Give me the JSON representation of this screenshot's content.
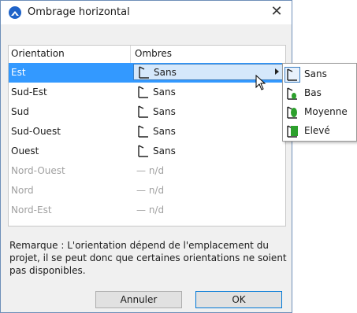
{
  "window": {
    "title": "Ombrage horizontal",
    "close_glyph": "✕",
    "app_icon": "app-logo-icon"
  },
  "table": {
    "headers": [
      "Orientation",
      "Ombres"
    ],
    "rows": [
      {
        "orientation": "Est",
        "shade": "Sans",
        "selected": true,
        "disabled": false
      },
      {
        "orientation": "Sud-Est",
        "shade": "Sans",
        "selected": false,
        "disabled": false
      },
      {
        "orientation": "Sud",
        "shade": "Sans",
        "selected": false,
        "disabled": false
      },
      {
        "orientation": "Sud-Ouest",
        "shade": "Sans",
        "selected": false,
        "disabled": false
      },
      {
        "orientation": "Ouest",
        "shade": "Sans",
        "selected": false,
        "disabled": false
      },
      {
        "orientation": "Nord-Ouest",
        "shade": "— n/d",
        "selected": false,
        "disabled": true
      },
      {
        "orientation": "Nord",
        "shade": "— n/d",
        "selected": false,
        "disabled": true
      },
      {
        "orientation": "Nord-Est",
        "shade": "— n/d",
        "selected": false,
        "disabled": true
      }
    ]
  },
  "submenu": {
    "items": [
      {
        "label": "Sans",
        "icon": "shade-none-icon",
        "current": true
      },
      {
        "label": "Bas",
        "icon": "shade-low-icon",
        "current": false
      },
      {
        "label": "Moyenne",
        "icon": "shade-medium-icon",
        "current": false
      },
      {
        "label": "Elevé",
        "icon": "shade-high-icon",
        "current": false
      }
    ]
  },
  "note": "Remarque : L'orientation dépend de l'emplacement du projet, il se peut donc que certaines orientations ne soient pas disponibles.",
  "buttons": {
    "cancel": "Annuler",
    "ok": "OK"
  },
  "colors": {
    "selection": "#3399ff",
    "plant": "#2ca02c",
    "accent": "#0078d7"
  }
}
